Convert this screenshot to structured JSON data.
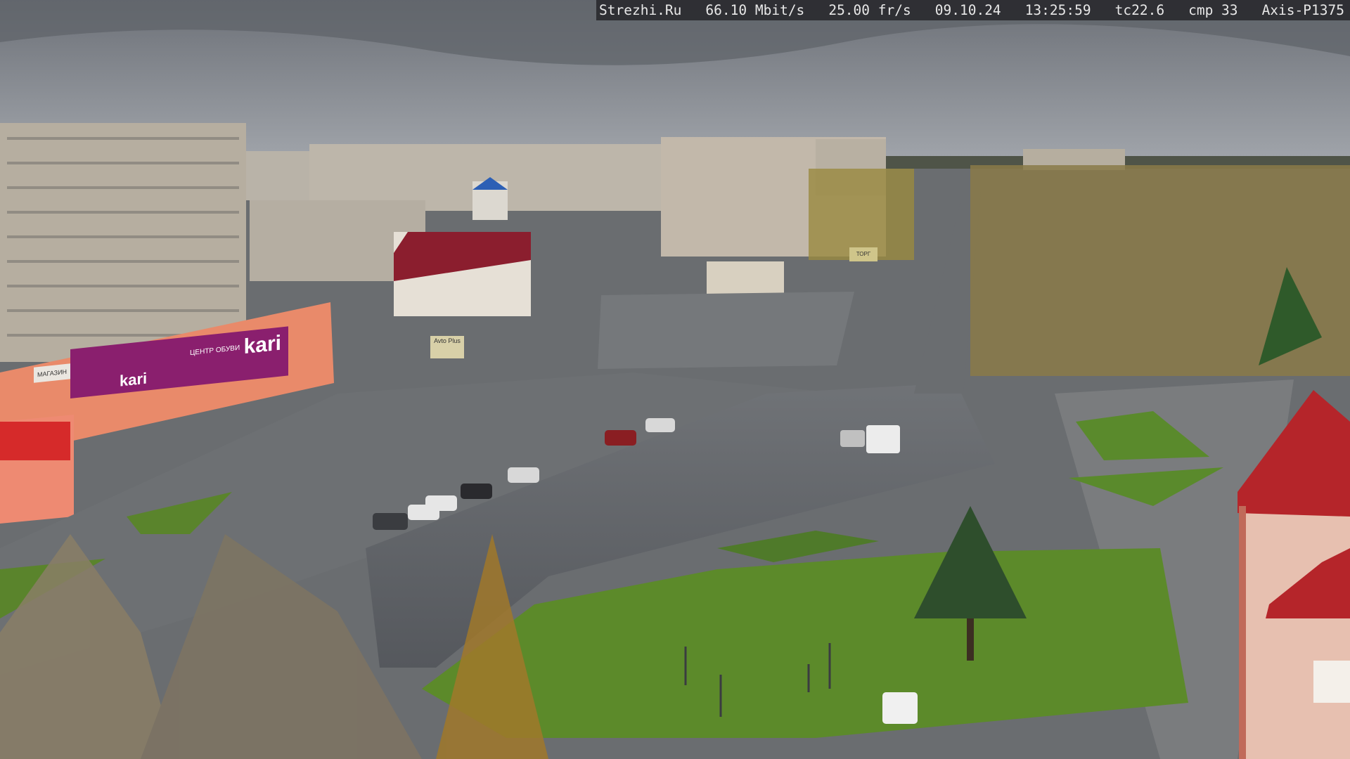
{
  "overlay": {
    "site": "Strezhi.Ru",
    "bandwidth": "66.10 Mbit/s",
    "framerate": "25.00 fr/s",
    "date": "09.10.24",
    "time": "13:25:59",
    "tc": "tc22.6",
    "cmp": "cmp 33",
    "camera": "Axis-P1375"
  },
  "signs": {
    "store_brand": "kari",
    "store_brand_lower": "kari",
    "store_small": "ЦЕНТР ОБУВИ",
    "store_label": "МАГАЗИН",
    "billboard": "Avto Plus",
    "billboard2": "ТОРГ"
  },
  "colors": {
    "sky": "#8a8f96",
    "asphalt": "#5d6066",
    "grass": "#5c8a2a",
    "store_sign": "#8a1f6e",
    "store_facade": "#e98a6a",
    "roof_red": "#b5252a",
    "building_wall": "#b8b2a6"
  }
}
